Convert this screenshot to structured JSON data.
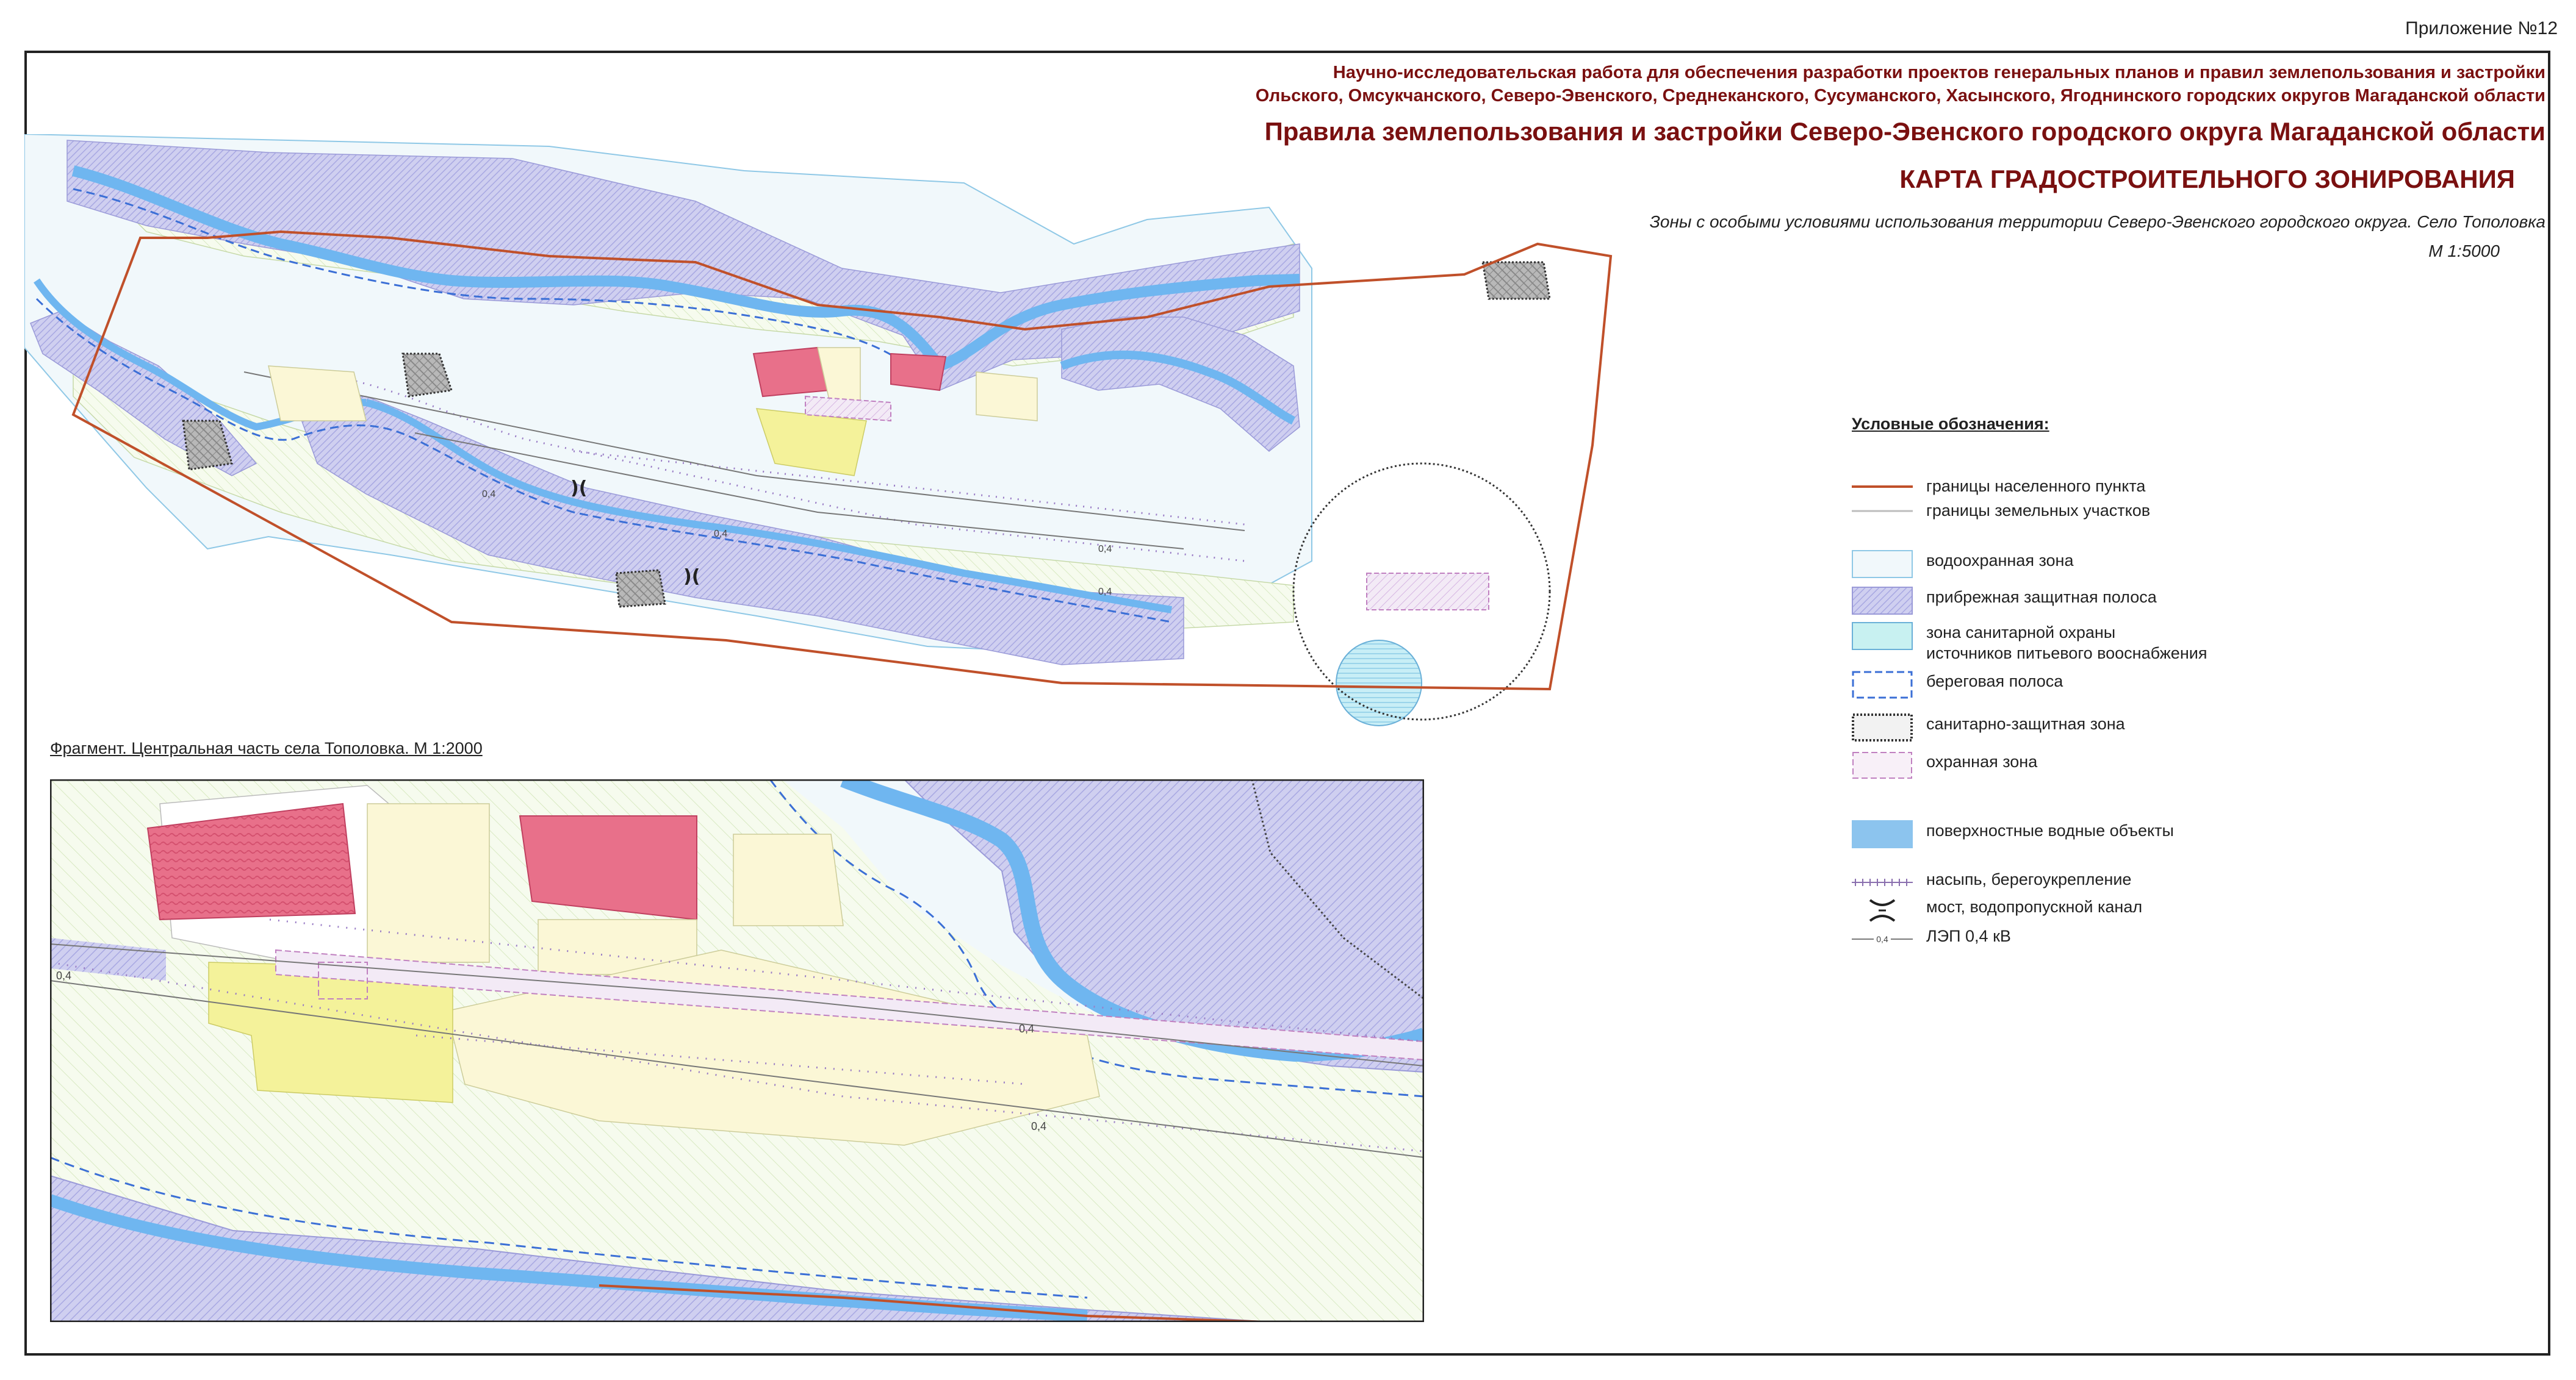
{
  "appendix": "Приложение №12",
  "title": {
    "line1": "Научно-исследовательская работа для обеспечения разработки проектов генеральных планов и правил землепользования и застройки",
    "line2": "Ольского, Омсукчанского, Северо-Эвенского, Среднеканского, Сусуманского, Хасынского, Ягоднинского городских округов Магаданской области",
    "main": "Правила землепользования и застройки Северо-Эвенского городского округа Магаданской области",
    "map_title": "КАРТА ГРАДОСТРОИТЕЛЬНОГО ЗОНИРОВАНИЯ",
    "subtitle": "Зоны с особыми условиями использования территории Северо-Эвенского городского округа. Село Тополовка",
    "scale": "М 1:5000"
  },
  "fragment_caption": "Фрагмент. Центральная часть села Тополовка. М 1:2000",
  "map_labels": {
    "power_line_value": "0,4"
  },
  "legend": {
    "title": "Условные обозначения:",
    "items": [
      {
        "key": "settlement_border",
        "label": "границы населенного пункта",
        "color": "#c0502a"
      },
      {
        "key": "land_plot_border",
        "label": "границы земельных участков",
        "color": "#bdbdbd"
      },
      {
        "key": "water_protection_zone",
        "label": "водоохранная зона",
        "color": "#f1f8fb"
      },
      {
        "key": "coastal_protection_strip",
        "label": "прибрежная защитная полоса",
        "color": "#c9c9ec"
      },
      {
        "key": "sanitary_zone_water",
        "label": "зона санитарной охраны\nисточников питьевого вооснабжения",
        "color": "#c8f1f1"
      },
      {
        "key": "shore_strip",
        "label": "береговая полоса",
        "color": "#3b6fd6"
      },
      {
        "key": "sanitary_protection_zone",
        "label": "санитарно-защитная зона",
        "color": "#444444"
      },
      {
        "key": "security_zone",
        "label": "охранная зона",
        "color": "#c080c0"
      },
      {
        "key": "surface_water",
        "label": "поверхностные водные объекты",
        "color": "#8cc4ee"
      },
      {
        "key": "embankment",
        "label": "насыпь, берегоукрепление",
        "color": "#8a6fae"
      },
      {
        "key": "bridge",
        "label": "мост, водопропускной канал",
        "color": "#222222"
      },
      {
        "key": "power_line",
        "label": "ЛЭП 0,4 кВ",
        "color": "#7a7a7a"
      }
    ]
  }
}
